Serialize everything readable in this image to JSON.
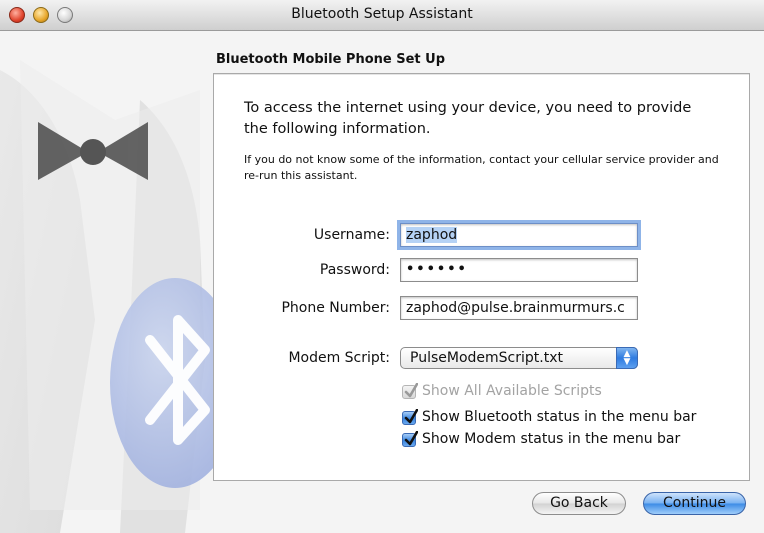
{
  "window": {
    "title": "Bluetooth Setup Assistant"
  },
  "page": {
    "heading": "Bluetooth Mobile Phone Set Up",
    "intro": "To access the internet using your device, you need to provide the following information.",
    "note": "If you do not know some of the information, contact your cellular service provider and re-run this assistant."
  },
  "form": {
    "username_label": "Username:",
    "username_value": "zaphod",
    "password_label": "Password:",
    "password_value": "••••••",
    "phone_label": "Phone Number:",
    "phone_value": "zaphod@pulse.brainmurmurs.c",
    "modem_label": "Modem Script:",
    "modem_value": "PulseModemScript.txt"
  },
  "checkboxes": [
    {
      "label": "Show All Available Scripts",
      "checked": true,
      "enabled": false
    },
    {
      "label": "Show Bluetooth status in the menu bar",
      "checked": true,
      "enabled": true
    },
    {
      "label": "Show Modem status in the menu bar",
      "checked": true,
      "enabled": true
    }
  ],
  "buttons": {
    "back": "Go Back",
    "continue": "Continue"
  },
  "icons": {
    "close": "close-traffic-light-icon",
    "minimize": "minimize-traffic-light-icon",
    "zoom": "zoom-traffic-light-icon",
    "popup": "popup-arrows-icon",
    "checkmark": "checkmark-icon",
    "bluetooth": "bluetooth-icon"
  },
  "colors": {
    "accent": "#3d8ce6",
    "selection": "#b5d2f5"
  }
}
